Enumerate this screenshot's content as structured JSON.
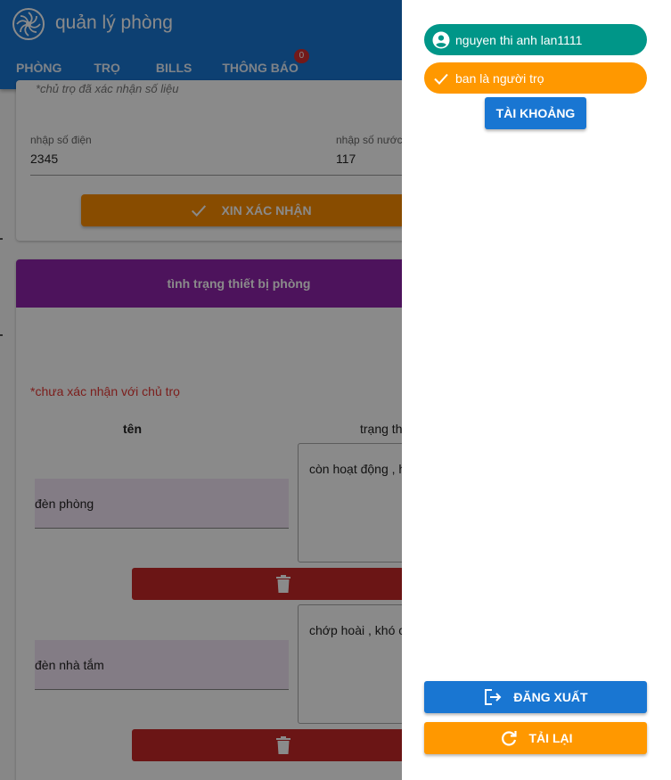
{
  "app": {
    "title": "quản lý phòng",
    "logo_icon": "flower-logo-icon",
    "tabs": [
      {
        "label": "PHÒNG"
      },
      {
        "label": "TRỌ"
      },
      {
        "label": "BILLS"
      },
      {
        "label": "THÔNG BÁO",
        "badge": "0"
      }
    ]
  },
  "meter_card": {
    "confirmed_note": "*chủ trọ đã xác nhận số liệu",
    "electric": {
      "label": "nhập số điện",
      "value": "2345"
    },
    "water": {
      "label": "nhập số nước",
      "value": "117"
    },
    "confirm_button": "XIN XÁC NHẬN"
  },
  "device_card": {
    "title": "tình trạng thiết bị phòng",
    "unconfirmed_note": "*chưa xác nhận với chủ trọ",
    "col_name": "tên",
    "col_status": "trạng th",
    "devices": [
      {
        "name": "đèn phòng",
        "status": "còn hoạt động , h"
      },
      {
        "name": "đèn nhà tắm",
        "status": "chớp hoài , khó c"
      }
    ]
  },
  "drawer": {
    "user_chip": "nguyen thi anh lan1111",
    "role_chip": "ban là người trọ",
    "account_button": "TÀI KHOẢNG",
    "logout_button": "ĐĂNG XUẤT",
    "reload_button": "TẢI LẠI"
  },
  "colors": {
    "primary": "#1976d2",
    "orange": "#ff9800",
    "teal": "#009688",
    "purple": "#8e24aa",
    "danger": "#c62828"
  }
}
